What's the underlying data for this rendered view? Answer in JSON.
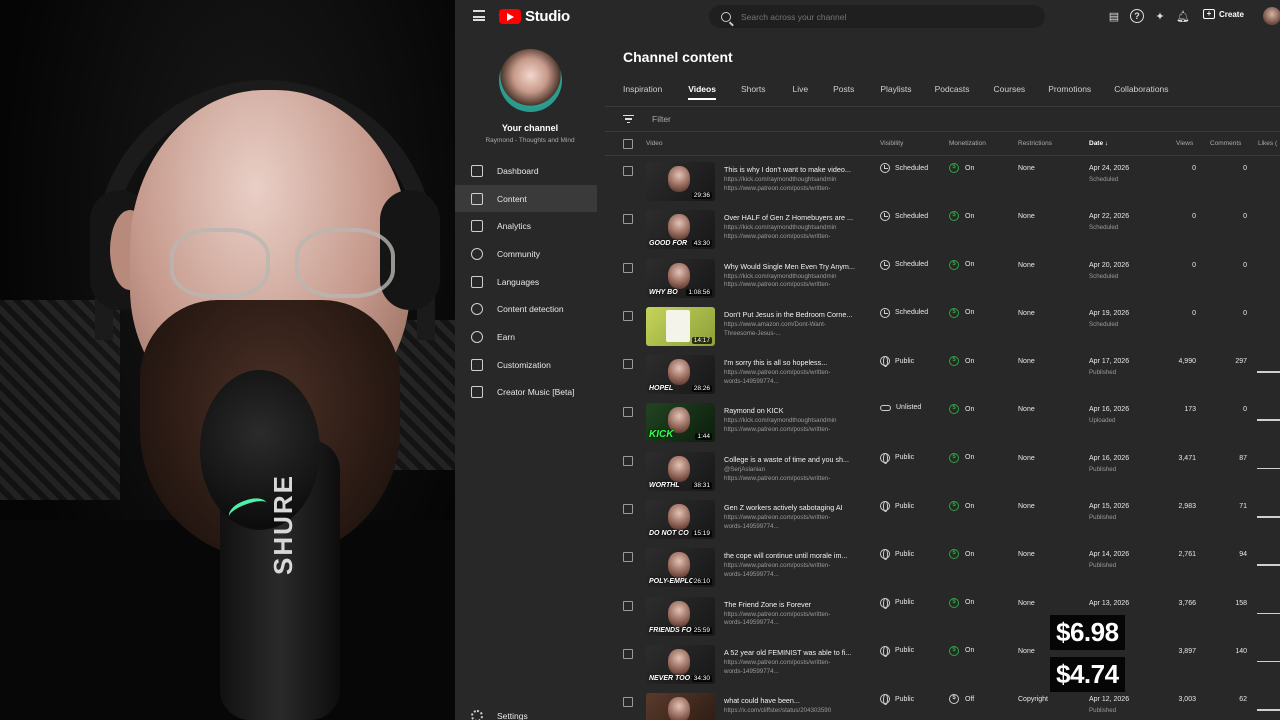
{
  "app": {
    "logo_text": "Studio",
    "search_placeholder": "Search across your channel",
    "create_label": "Create"
  },
  "webcam": {
    "mic_brand": "SHURE"
  },
  "sidebar": {
    "channel_title": "Your channel",
    "channel_name": "Raymond - Thoughts and Mind",
    "items": [
      {
        "label": "Dashboard",
        "icon": "dashboard-icon"
      },
      {
        "label": "Content",
        "icon": "content-icon",
        "active": true
      },
      {
        "label": "Analytics",
        "icon": "analytics-icon"
      },
      {
        "label": "Community",
        "icon": "community-icon"
      },
      {
        "label": "Languages",
        "icon": "languages-icon"
      },
      {
        "label": "Content detection",
        "icon": "content-detection-icon"
      },
      {
        "label": "Earn",
        "icon": "earn-icon"
      },
      {
        "label": "Customization",
        "icon": "customization-icon"
      },
      {
        "label": "Creator Music [Beta]",
        "icon": "creator-music-icon"
      }
    ],
    "settings_label": "Settings"
  },
  "main": {
    "page_title": "Channel content",
    "tabs": [
      "Inspiration",
      "Videos",
      "Shorts",
      "Live",
      "Posts",
      "Playlists",
      "Podcasts",
      "Courses",
      "Promotions",
      "Collaborations"
    ],
    "active_tab": "Videos",
    "filter_label": "Filter",
    "columns": {
      "video": "Video",
      "visibility": "Visibility",
      "monetization": "Monetization",
      "restrictions": "Restrictions",
      "date": "Date",
      "views": "Views",
      "comments": "Comments",
      "likes": "Likes ("
    },
    "rows": [
      {
        "title": "This is why I don't want to make video...",
        "desc": "https://kick.com/raymondthoughtsandmin\nhttps://www.patreon.com/posts/written-",
        "thumb_caption": "",
        "duration": "29:36",
        "visibility": "Scheduled",
        "vis_icon": "clock",
        "monetization": "On",
        "restrictions": "None",
        "date": "Apr 24, 2026",
        "date_status": "Scheduled",
        "views": "0",
        "comments": "0"
      },
      {
        "title": "Over HALF of Gen Z Homebuyers are ...",
        "desc": "https://kick.com/raymondthoughtsandmin\nhttps://www.patreon.com/posts/written-",
        "thumb_caption": "GOOD FOR",
        "duration": "43:30",
        "visibility": "Scheduled",
        "vis_icon": "clock",
        "monetization": "On",
        "restrictions": "None",
        "date": "Apr 22, 2026",
        "date_status": "Scheduled",
        "views": "0",
        "comments": "0"
      },
      {
        "title": "Why Would Single Men Even Try Anym...",
        "desc": "https://kick.com/raymondthoughtsandmin\nhttps://www.patreon.com/posts/written-",
        "thumb_caption": "WHY BO",
        "duration": "1:08:56",
        "visibility": "Scheduled",
        "vis_icon": "clock",
        "monetization": "On",
        "restrictions": "None",
        "date": "Apr 20, 2026",
        "date_status": "Scheduled",
        "views": "0",
        "comments": "0"
      },
      {
        "title": "Don't Put Jesus in the Bedroom Corne...",
        "desc": "https://www.amazon.com/Dont-Want-\nThreesome-Jesus-...",
        "thumb_caption": "",
        "duration": "14:17",
        "visibility": "Scheduled",
        "vis_icon": "clock",
        "monetization": "On",
        "restrictions": "None",
        "date": "Apr 19, 2026",
        "date_status": "Scheduled",
        "views": "0",
        "comments": "0",
        "thumb_style": "yellow"
      },
      {
        "title": "I'm sorry this is all so hopeless...",
        "desc": "https://www.patreon.com/posts/written-\nwords-149599774...",
        "thumb_caption": "HOPEL",
        "duration": "28:26",
        "visibility": "Public",
        "vis_icon": "globe",
        "monetization": "On",
        "restrictions": "None",
        "date": "Apr 17, 2026",
        "date_status": "Published",
        "views": "4,990",
        "comments": "297"
      },
      {
        "title": "Raymond on KICK",
        "desc": "https://kick.com/raymondthoughtsandmin\nhttps://www.patreon.com/posts/written-",
        "thumb_caption": "KICK",
        "duration": "1:44",
        "visibility": "Unlisted",
        "vis_icon": "link",
        "monetization": "On",
        "restrictions": "None",
        "date": "Apr 16, 2026",
        "date_status": "Uploaded",
        "views": "173",
        "comments": "0",
        "thumb_style": "green"
      },
      {
        "title": "College is a waste of time and you sh...",
        "desc": "@SerjAslanian\nhttps://www.patreon.com/posts/written-",
        "thumb_caption": "WORTHL",
        "duration": "38:31",
        "visibility": "Public",
        "vis_icon": "globe",
        "monetization": "On",
        "restrictions": "None",
        "date": "Apr 16, 2026",
        "date_status": "Published",
        "views": "3,471",
        "comments": "87"
      },
      {
        "title": "Gen Z workers actively sabotaging AI",
        "desc": "https://www.patreon.com/posts/written-\nwords-149599774...",
        "thumb_caption": "DO NOT CO",
        "duration": "15:19",
        "visibility": "Public",
        "vis_icon": "globe",
        "monetization": "On",
        "restrictions": "None",
        "date": "Apr 15, 2026",
        "date_status": "Published",
        "views": "2,983",
        "comments": "71"
      },
      {
        "title": "the cope will continue until morale im...",
        "desc": "https://www.patreon.com/posts/written-\nwords-149599774...",
        "thumb_caption": "POLY-EMPLO",
        "duration": "26:10",
        "visibility": "Public",
        "vis_icon": "globe",
        "monetization": "On",
        "restrictions": "None",
        "date": "Apr 14, 2026",
        "date_status": "Published",
        "views": "2,761",
        "comments": "94"
      },
      {
        "title": "The Friend Zone is Forever",
        "desc": "https://www.patreon.com/posts/written-\nwords-149599774...",
        "thumb_caption": "FRIENDS FO",
        "duration": "25:59",
        "visibility": "Public",
        "vis_icon": "globe",
        "monetization": "On",
        "restrictions": "None",
        "date": "Apr 13, 2026",
        "date_status": "",
        "views": "3,766",
        "comments": "158"
      },
      {
        "title": "A 52 year old FEMINIST was able to fi...",
        "desc": "https://www.patreon.com/posts/written-\nwords-149599774...",
        "thumb_caption": "NEVER TOO",
        "duration": "34:30",
        "visibility": "Public",
        "vis_icon": "globe",
        "monetization": "On",
        "restrictions": "None",
        "date": "",
        "date_status": "",
        "views": "3,897",
        "comments": "140"
      },
      {
        "title": "what could have been...",
        "desc": "https://x.com/cliffster/status/204303590",
        "thumb_caption": "",
        "duration": "",
        "visibility": "Public",
        "vis_icon": "globe",
        "monetization": "Off",
        "restrictions": "Copyright",
        "date": "Apr 12, 2026",
        "date_status": "Published",
        "views": "3,003",
        "comments": "62",
        "thumb_style": "brown"
      }
    ]
  },
  "overlay": {
    "earning_1": "$6.98",
    "earning_2": "$4.74"
  },
  "colors": {
    "studio_bg": "#282828",
    "accent_red": "#ff0000",
    "monetization_green": "#2ba640"
  }
}
